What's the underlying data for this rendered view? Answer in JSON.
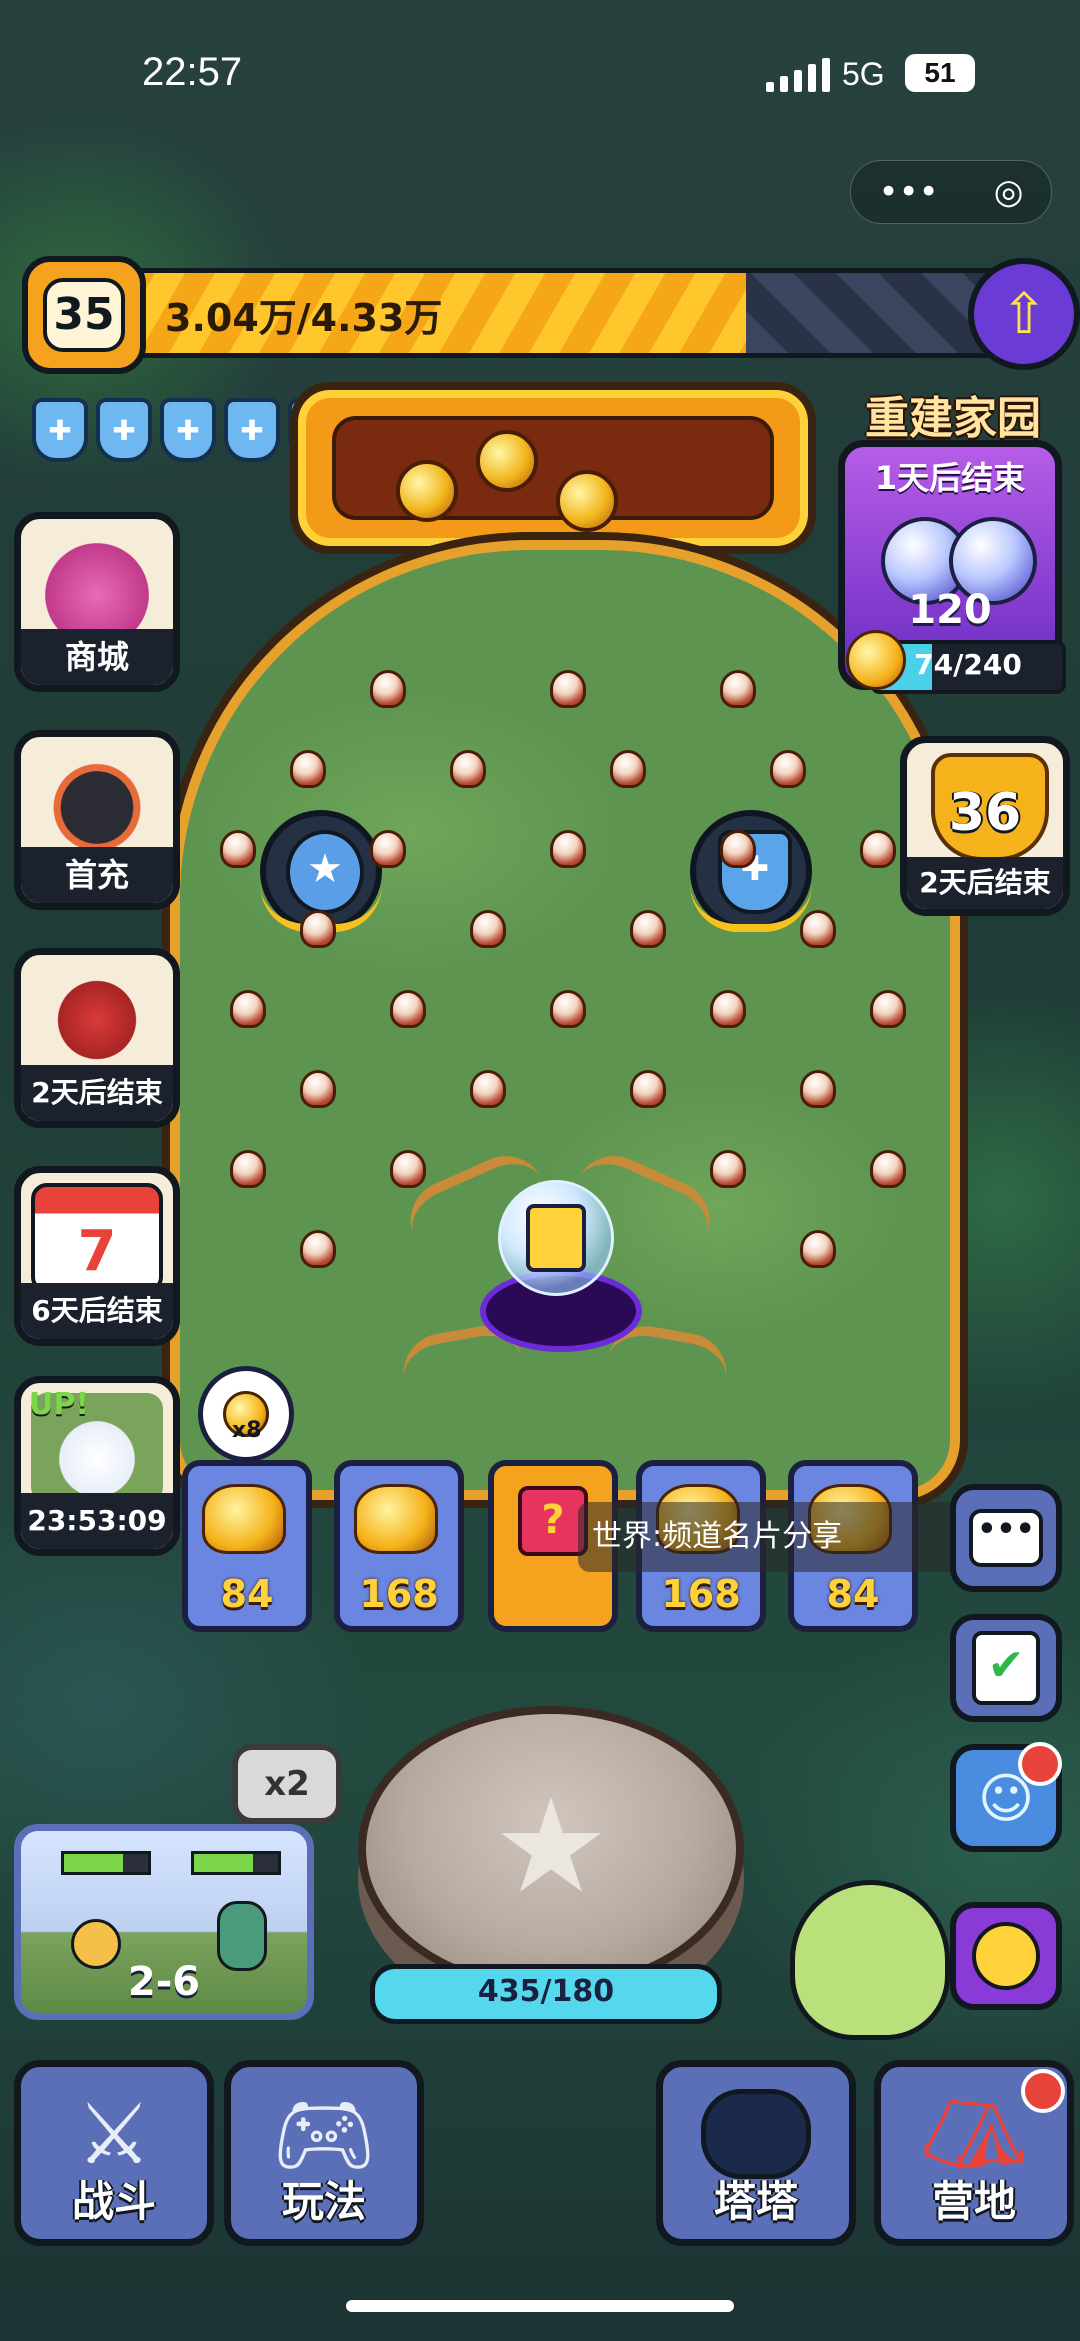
{
  "status": {
    "time": "22:57",
    "network": "5G",
    "battery": "51"
  },
  "capsule": {
    "more": "•••",
    "close": "◎"
  },
  "player": {
    "level": "35",
    "xp_text": "3.04万/4.33万",
    "xp_progress": 0.7,
    "shield_count": 5
  },
  "left_buttons": [
    {
      "label": "商城"
    },
    {
      "label": "首充"
    },
    {
      "label": "2天后结束"
    },
    {
      "label": "6天后结束"
    },
    {
      "label": "23:53:09",
      "badge": "UP!"
    }
  ],
  "rebuild_event": {
    "title": "重建家园",
    "timer": "1天后结束",
    "reward": "120",
    "progress_text": "74/240",
    "progress": 0.31
  },
  "trophy_event": {
    "value": "36",
    "timer": "2天后结束"
  },
  "bonus_item": {
    "count": "x8"
  },
  "slots": [
    "84",
    "168",
    "?",
    "168",
    "84"
  ],
  "world_chat": "世界:频道名片分享",
  "stage": {
    "multiplier": "x2",
    "label": "2-6"
  },
  "launch": {
    "text": "435/180",
    "progress": 1.0
  },
  "nav": [
    {
      "label": "战斗"
    },
    {
      "label": "玩法"
    },
    {
      "label": "塔塔"
    },
    {
      "label": "营地"
    }
  ],
  "colors": {
    "accent_yellow": "#ffc72c",
    "panel_blue": "#5b6fb8",
    "outline": "#12181f"
  }
}
